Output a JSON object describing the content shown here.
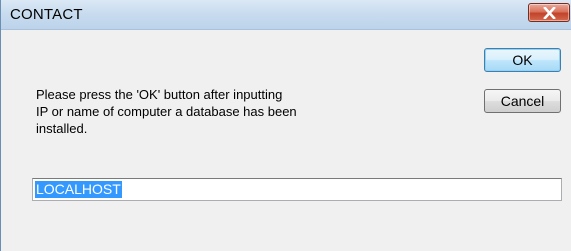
{
  "window": {
    "title": "CONTACT",
    "close_icon": "close-icon"
  },
  "dialog": {
    "message": "Please press the 'OK' button after inputting\nIP or name of computer a database has been\ninstalled.",
    "ok_label": "OK",
    "cancel_label": "Cancel",
    "input_value": "LOCALHOST",
    "input_selected": true
  },
  "colors": {
    "selection": "#3399ff",
    "close_button": "#c2432a",
    "dialog_background": "#f0f0f0"
  }
}
